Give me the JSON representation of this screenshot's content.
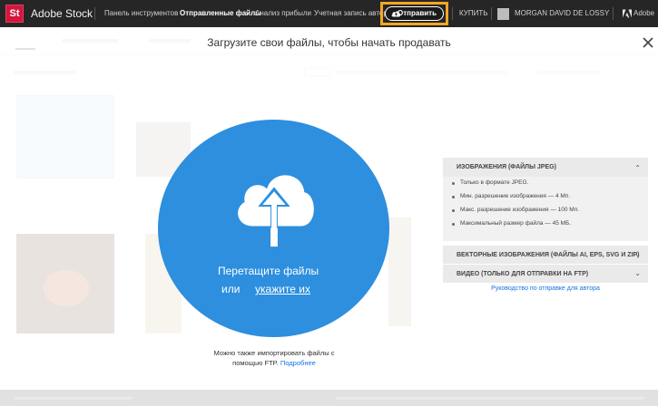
{
  "topbar": {
    "logo": "St",
    "brand": "Adobe Stock",
    "nav": [
      "Панель инструментов",
      "Отправленные файлы",
      "Анализ прибыли",
      "Учетная запись автора"
    ],
    "upload_label": "Отправить",
    "buy_label": "КУПИТЬ",
    "user_name": "MORGAN DAVID DE LOSSY",
    "adobe_label": "Adobe"
  },
  "modal": {
    "title": "Загрузите свои файлы, чтобы начать продавать",
    "drop_text": "Перетащите файлы",
    "or_text": "или",
    "browse_link": "укажите их",
    "ftp_note": "Можно также импортировать файлы с помощью FTP.",
    "ftp_link": "Подробнее"
  },
  "panel": {
    "images_header": "ИЗОБРАЖЕНИЯ (ФАЙЛЫ JPEG)",
    "image_rules": [
      "Только в формате JPEG.",
      "Мин. разрешение изображения — 4 Мп.",
      "Макс. разрешение изображения — 100 Мп.",
      "Максимальный размер файла — 45 МБ."
    ],
    "vector_header": "ВЕКТОРНЫЕ ИЗОБРАЖЕНИЯ (ФАЙЛЫ AI, EPS, SVG И ZIP)",
    "video_header": "ВИДЕО (ТОЛЬКО ДЛЯ ОТПРАВКИ НА FTP)",
    "guide_link": "Руководство по отправке для автора"
  },
  "colors": {
    "topbar": "#262626",
    "accent": "#2d8fde",
    "highlight": "#f5a623",
    "link": "#1473e6"
  }
}
